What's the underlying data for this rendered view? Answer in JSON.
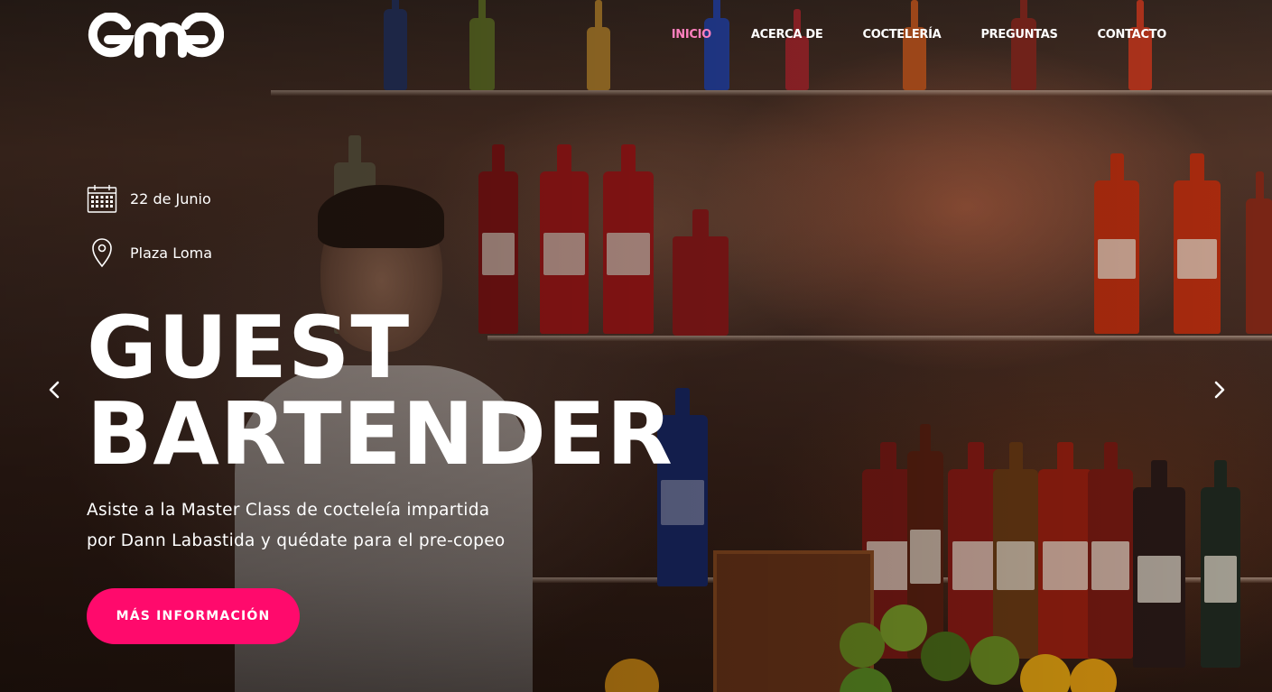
{
  "brand": {
    "logo_icon": "gmg-logo"
  },
  "nav": {
    "items": [
      {
        "label": "INICIO",
        "active": true
      },
      {
        "label": "ACERCA DE",
        "active": false
      },
      {
        "label": "COCTELERÍA",
        "active": false
      },
      {
        "label": "PREGUNTAS",
        "active": false
      },
      {
        "label": "CONTACTO",
        "active": false
      }
    ],
    "active_color": "#ff80bf"
  },
  "hero": {
    "date": "22 de Junio",
    "date_icon": "calendar-icon",
    "location": "Plaza Loma",
    "location_icon": "map-pin-icon",
    "title_line1": "GUEST",
    "title_line2": "BARTENDER",
    "subtitle_line1": "Asiste a la Master Class de cocteleía impartida",
    "subtitle_line2": "por Dann Labastida y quédate para el pre-copeo",
    "cta_label": "MÁS INFORMACIÓN",
    "cta_color": "#ff0a6c"
  },
  "carousel": {
    "prev_icon": "chevron-left-icon",
    "next_icon": "chevron-right-icon"
  }
}
